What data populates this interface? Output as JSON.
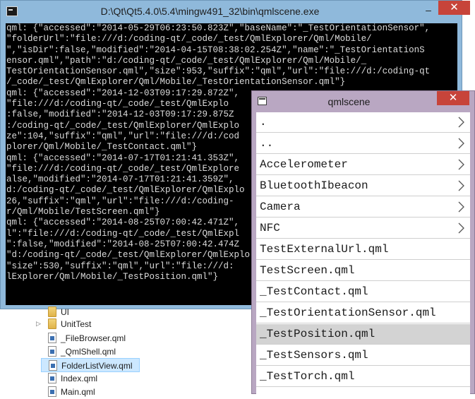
{
  "console": {
    "title": "D:\\Qt\\Qt5.4.0\\5.4\\mingw491_32\\bin\\qmlscene.exe",
    "minimize": "–",
    "close": "✕",
    "lines": [
      "qml: {\"accessed\":\"2014-05-29T06:23:50.823Z\",\"baseName\":\"_TestOrientationSensor\",",
      "\"folderUrl\":\"file:///d:/coding-qt/_code/_test/QmlExplorer/Qml/Mobile/",
      "\",\"isDir\":false,\"modified\":\"2014-04-15T08:38:02.254Z\",\"name\":\"_TestOrientationS",
      "ensor.qml\",\"path\":\"d:/coding-qt/_code/_test/QmlExplorer/Qml/Mobile/_",
      "TestOrientationSensor.qml\",\"size\":953,\"suffix\":\"qml\",\"url\":\"file:///d:/coding-qt",
      "/_code/_test/QmlExplorer/Qml/Mobile/_TestOrientationSensor.qml\"}",
      "qml: {\"accessed\":\"2014-12-03T09:17:29.872Z\",",
      "\"file:///d:/coding-qt/_code/_test/QmlExplo",
      ":false,\"modified\":\"2014-12-03T09:17:29.875Z",
      ":/coding-qt/_code/_test/QmlExplorer/QmlExplo",
      "ze\":104,\"suffix\":\"qml\",\"url\":\"file:///d:/cod",
      "plorer/Qml/Mobile/_TestContact.qml\"}",
      "qml: {\"accessed\":\"2014-07-17T01:21:41.353Z\",",
      "\"file:///d:/coding-qt/_code/_test/QmlExplore",
      "alse,\"modified\":\"2014-07-17T01:21:41.359Z\",",
      "d:/coding-qt/_code/_test/QmlExplorer/QmlExplo",
      "26,\"suffix\":\"qml\",\"url\":\"file:///d:/coding-",
      "r/Qml/Mobile/TestScreen.qml\"}",
      "qml: {\"accessed\":\"2014-08-25T07:00:42.471Z\",",
      "l\":\"file:///d:/coding-qt/_code/_test/QmlExpl",
      "\":false,\"modified\":\"2014-08-25T07:00:42.474Z",
      "\"d:/coding-qt/_code/_test/QmlExplorer/QmlExplo",
      "\"size\":530,\"suffix\":\"qml\",\"url\":\"file:///d:",
      "lExplorer/Qml/Mobile/_TestPosition.qml\"}"
    ]
  },
  "tree": {
    "items": [
      {
        "label": "UI",
        "type": "folder",
        "expander": "",
        "selected": false
      },
      {
        "label": "UnitTest",
        "type": "folder",
        "expander": "▷",
        "selected": false
      },
      {
        "label": "_FileBrowser.qml",
        "type": "qml",
        "expander": "",
        "selected": false
      },
      {
        "label": "_QmlShell.qml",
        "type": "qml",
        "expander": "",
        "selected": false
      },
      {
        "label": "FolderListView.qml",
        "type": "qml",
        "expander": "",
        "selected": true
      },
      {
        "label": "Index.qml",
        "type": "qml",
        "expander": "",
        "selected": false
      },
      {
        "label": "Main.qml",
        "type": "qml",
        "expander": "",
        "selected": false
      }
    ]
  },
  "qmlscene": {
    "title": "qmlscene",
    "close": "✕",
    "highlight_color": "#d3d3d3",
    "items": [
      {
        "label": ".",
        "is_dir": true,
        "highlighted": false
      },
      {
        "label": "..",
        "is_dir": true,
        "highlighted": false
      },
      {
        "label": "Accelerometer",
        "is_dir": true,
        "highlighted": false
      },
      {
        "label": "BluetoothIbeacon",
        "is_dir": true,
        "highlighted": false
      },
      {
        "label": "Camera",
        "is_dir": true,
        "highlighted": false
      },
      {
        "label": "NFC",
        "is_dir": true,
        "highlighted": false
      },
      {
        "label": "TestExternalUrl.qml",
        "is_dir": false,
        "highlighted": false
      },
      {
        "label": "TestScreen.qml",
        "is_dir": false,
        "highlighted": false
      },
      {
        "label": "_TestContact.qml",
        "is_dir": false,
        "highlighted": false
      },
      {
        "label": "_TestOrientationSensor.qml",
        "is_dir": false,
        "highlighted": false
      },
      {
        "label": "_TestPosition.qml",
        "is_dir": false,
        "highlighted": true
      },
      {
        "label": "_TestSensors.qml",
        "is_dir": false,
        "highlighted": false
      },
      {
        "label": "_TestTorch.qml",
        "is_dir": false,
        "highlighted": false
      }
    ]
  }
}
